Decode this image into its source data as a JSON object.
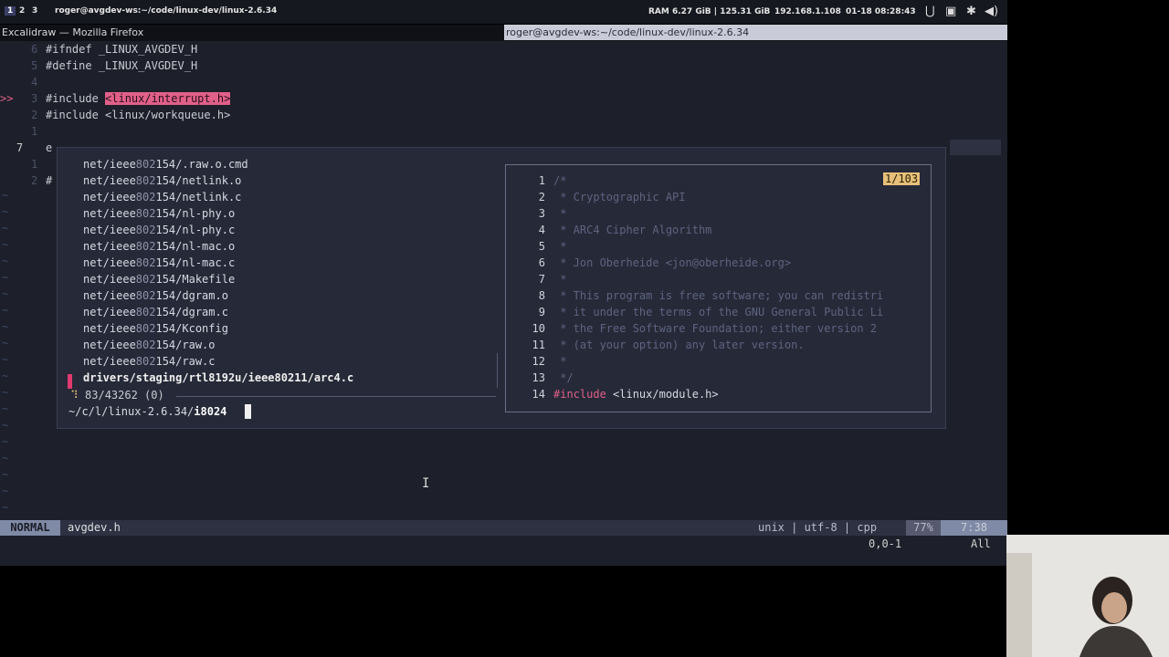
{
  "topbar": {
    "workspaces": [
      "1",
      "2",
      "3"
    ],
    "title": "roger@avgdev-ws:~/code/linux-dev/linux-2.6.34",
    "ram": "RAM 6.27 GiB | 125.31 GiB",
    "ip": "192.168.1.108",
    "datetime": "01-18 08:28:43"
  },
  "window": {
    "left_title": "Excalidraw — Mozilla Firefox",
    "right_title": "roger@avgdev-ws:~/code/linux-dev/linux-2.6.34"
  },
  "editor": {
    "lines": [
      {
        "num": "6",
        "text": "#ifndef _LINUX_AVGDEV_H"
      },
      {
        "num": "5",
        "text": "#define _LINUX_AVGDEV_H"
      },
      {
        "num": "4",
        "text": ""
      },
      {
        "num": "3",
        "text": "#include ",
        "highlight": "<linux/interrupt.h>",
        "mark": ">>"
      },
      {
        "num": "2",
        "text": "#include <linux/workqueue.h>"
      },
      {
        "num": "1",
        "text": ""
      },
      {
        "num": "7",
        "text": "e"
      },
      {
        "num": "1",
        "text": ""
      },
      {
        "num": "2",
        "text": "#"
      }
    ],
    "tilde": "~"
  },
  "fzf": {
    "items": [
      {
        "prefix": "net/ieee",
        "match": "802",
        "suffix": "154/.raw.o.cmd"
      },
      {
        "prefix": "net/ieee",
        "match": "802",
        "suffix": "154/netlink.o"
      },
      {
        "prefix": "net/ieee",
        "match": "802",
        "suffix": "154/netlink.c"
      },
      {
        "prefix": "net/ieee",
        "match": "802",
        "suffix": "154/nl-phy.o"
      },
      {
        "prefix": "net/ieee",
        "match": "802",
        "suffix": "154/nl-phy.c"
      },
      {
        "prefix": "net/ieee",
        "match": "802",
        "suffix": "154/nl-mac.o"
      },
      {
        "prefix": "net/ieee",
        "match": "802",
        "suffix": "154/nl-mac.c"
      },
      {
        "prefix": "net/ieee",
        "match": "802",
        "suffix": "154/Makefile"
      },
      {
        "prefix": "net/ieee",
        "match": "802",
        "suffix": "154/dgram.o"
      },
      {
        "prefix": "net/ieee",
        "match": "802",
        "suffix": "154/dgram.c"
      },
      {
        "prefix": "net/ieee",
        "match": "802",
        "suffix": "154/Kconfig"
      },
      {
        "prefix": "net/ieee",
        "match": "802",
        "suffix": "154/raw.o"
      },
      {
        "prefix": "net/ieee",
        "match": "802",
        "suffix": "154/raw.c"
      }
    ],
    "selected": "drivers/staging/rtl8192u/ieee80211/arc4.c",
    "counter_dot": "⠹",
    "counter": "83/43262 (0)",
    "prompt_path": "~/c/l/linux-2.6.34/",
    "query": "i8024"
  },
  "preview": {
    "count": "1/103",
    "lines": [
      {
        "n": "1",
        "t": "/*",
        "kind": "comment"
      },
      {
        "n": "2",
        "t": " * Cryptographic API",
        "kind": "comment"
      },
      {
        "n": "3",
        "t": " *",
        "kind": "comment"
      },
      {
        "n": "4",
        "t": " * ARC4 Cipher Algorithm",
        "kind": "comment"
      },
      {
        "n": "5",
        "t": " *",
        "kind": "comment"
      },
      {
        "n": "6",
        "t": " * Jon Oberheide <jon@oberheide.org>",
        "kind": "comment"
      },
      {
        "n": "7",
        "t": " *",
        "kind": "comment"
      },
      {
        "n": "8",
        "t": " * This program is free software; you can redistri",
        "kind": "comment"
      },
      {
        "n": "9",
        "t": " * it under the terms of the GNU General Public Li",
        "kind": "comment"
      },
      {
        "n": "10",
        "t": " * the Free Software Foundation; either version 2",
        "kind": "comment"
      },
      {
        "n": "11",
        "t": " * (at your option) any later version.",
        "kind": "comment"
      },
      {
        "n": "12",
        "t": " *",
        "kind": "comment"
      },
      {
        "n": "13",
        "t": " */",
        "kind": "comment"
      },
      {
        "n": "14",
        "t": "#include",
        "rest": " <linux/module.h>",
        "kind": "include"
      }
    ]
  },
  "statusline": {
    "mode": "NORMAL",
    "file": "avgdev.h",
    "encoding": "unix | utf-8 | cpp",
    "percent": "77%",
    "position": "7:38"
  },
  "cmdline": {
    "position": "0,0-1",
    "scroll": "All"
  },
  "colors": {
    "editor_bg": "#1d1f2a",
    "popup_bg": "#262937",
    "accent_pink": "#e0608a",
    "accent_yellow": "#e6c07b"
  }
}
